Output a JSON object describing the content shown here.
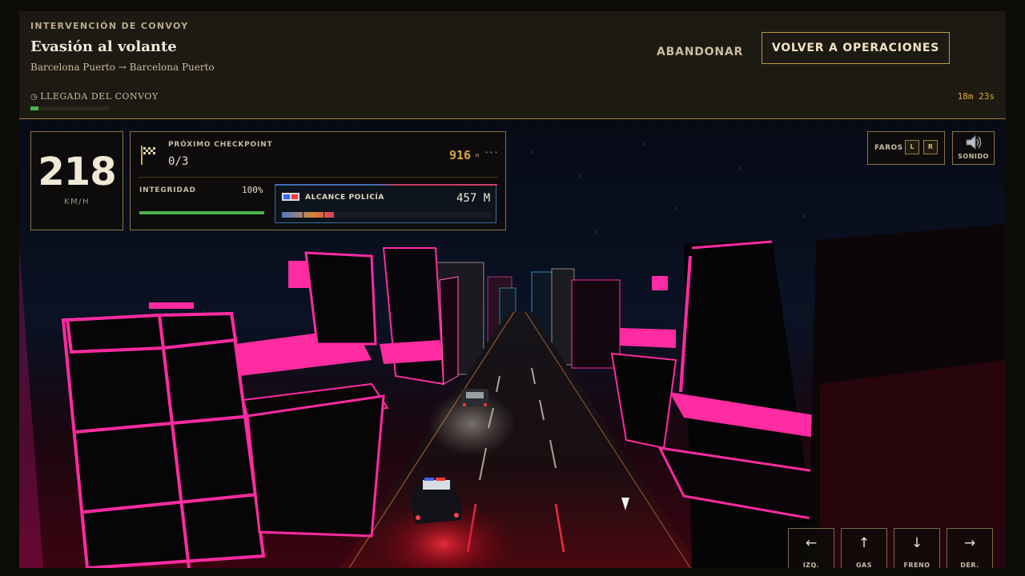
{
  "header": {
    "eyebrow": "INTERVENCIÓN DE CONVOY",
    "title": "Evasión al volante",
    "route": "Barcelona Puerto → Barcelona Puerto",
    "abandon_label": "ABANDONAR",
    "ops_label": "VOLVER A OPERACIONES",
    "arrival_label": "LLEGADA DEL CONVOY",
    "arrival_progress": 0.1,
    "timer": "18m 23s"
  },
  "hud": {
    "speed": "218",
    "speed_unit": "KM/H",
    "checkpoint_label": "PRÓXIMO CHECKPOINT",
    "checkpoint_value": "0/3",
    "checkpoint_distance": "916",
    "checkpoint_distance_unit": "M",
    "integrity_label": "INTEGRIDAD",
    "integrity_value": "100%",
    "integrity_fraction": 1.0,
    "police_label": "ALCANCE POLICÍA",
    "police_value": "457 M",
    "police_fraction": 0.25,
    "lights_label": "FAROS",
    "lights_key_left": "L",
    "lights_key_right": "R",
    "sound_label": "SONIDO"
  },
  "controls": [
    {
      "arrow": "←",
      "label": "IZQ."
    },
    {
      "arrow": "↑",
      "label": "GAS"
    },
    {
      "arrow": "↓",
      "label": "FRENO"
    },
    {
      "arrow": "→",
      "label": "DER."
    }
  ],
  "colors": {
    "accent_gold": "#c29a45",
    "neon_magenta": "#ff2ba0",
    "progress_green": "#4bb44b",
    "timer_orange": "#e0a93c"
  }
}
